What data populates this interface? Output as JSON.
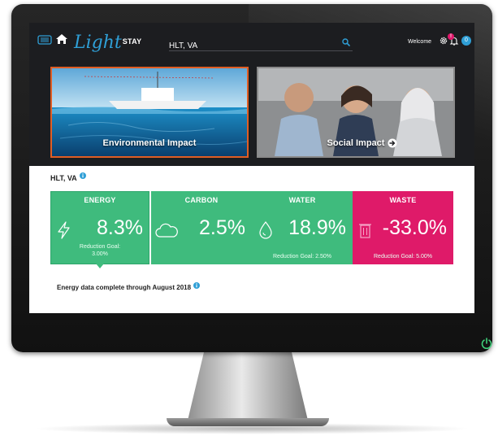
{
  "header": {
    "logo_light": "Light",
    "logo_stay": "STAY",
    "search_value": "HLT, VA",
    "welcome": "Welcome",
    "bell_badge": "!",
    "count_badge": "0"
  },
  "banners": [
    {
      "label": "Environmental Impact",
      "border_color": "#e05d24"
    },
    {
      "label": "Social Impact",
      "border_color": "#8a8a8a"
    }
  ],
  "location": "HLT, VA",
  "cards": [
    {
      "title": "ENERGY",
      "value": "8.3%",
      "goal_label": "Reduction Goal:",
      "goal_value": "3.00%",
      "color": "#3fbb7d"
    },
    {
      "title": "CARBON",
      "value": "2.5%",
      "color": "#3fbb7d"
    },
    {
      "title": "WATER",
      "value": "18.9%",
      "goal": "Reduction Goal: 2.50%",
      "color": "#3fbb7d"
    },
    {
      "title": "WASTE",
      "value": "-33.0%",
      "goal": "Reduction Goal: 5.00%",
      "color": "#df1a69"
    }
  ],
  "note": "Energy data complete through August 2018",
  "colors": {
    "accent_blue": "#2f9fd6",
    "topbar": "#1c1d20"
  }
}
